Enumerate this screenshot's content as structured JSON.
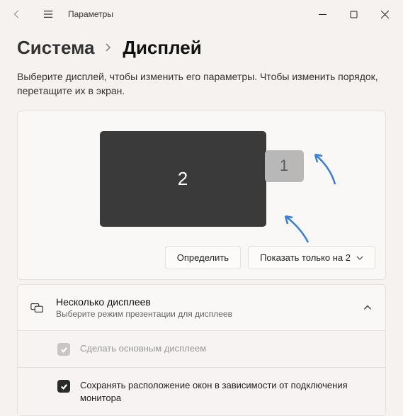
{
  "window": {
    "title": "Параметры"
  },
  "breadcrumb": {
    "parent": "Система",
    "current": "Дисплей"
  },
  "description": "Выберите дисплей, чтобы изменить его параметры. Чтобы изменить порядок, перетащите их в экран.",
  "monitors": {
    "primary_label": "2",
    "secondary_label": "1"
  },
  "actions": {
    "identify": "Определить",
    "mode_selected": "Показать только на 2"
  },
  "expander": {
    "title": "Несколько дисплеев",
    "subtitle": "Выберите режим презентации для дисплеев"
  },
  "options": {
    "make_main": "Сделать основным дисплеем",
    "remember_layout": "Сохранять расположение окон в зависимости от подключения монитора"
  }
}
